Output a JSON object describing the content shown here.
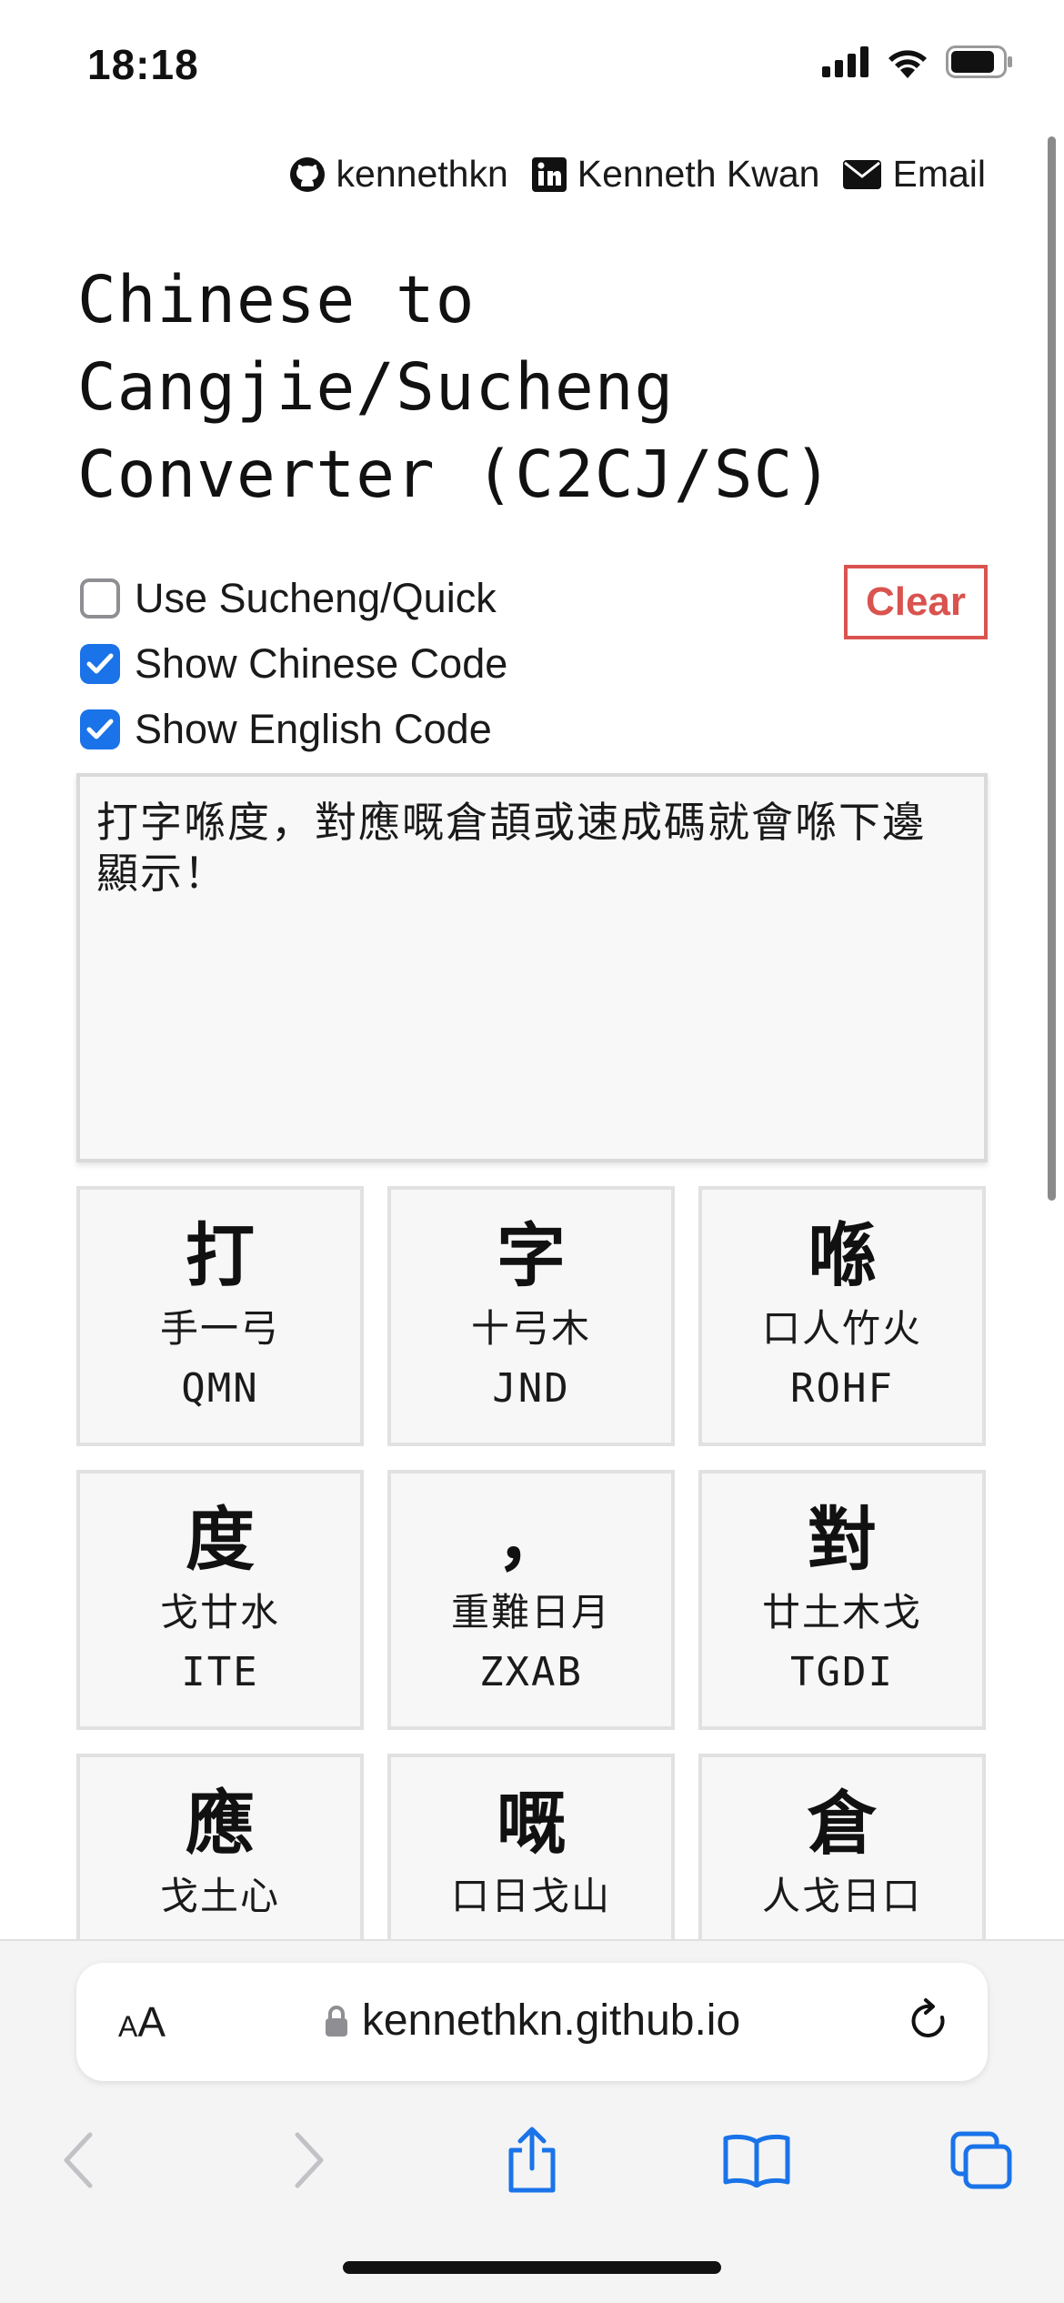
{
  "status_bar": {
    "time": "18:18"
  },
  "social": {
    "github": "kennethkn",
    "linkedin": "Kenneth Kwan",
    "email": "Email"
  },
  "title": "Chinese to Cangjie/Sucheng Converter (C2CJ/SC)",
  "options": {
    "sucheng": {
      "label": "Use Sucheng/Quick",
      "checked": false
    },
    "chinese_code": {
      "label": "Show Chinese Code",
      "checked": true
    },
    "english_code": {
      "label": "Show English Code",
      "checked": true
    }
  },
  "clear_label": "Clear",
  "input_text": "打字喺度，對應嘅倉頡或速成碼就會喺下邊顯示！",
  "results": [
    {
      "char": "打",
      "radicals": "手一弓",
      "code": "QMN"
    },
    {
      "char": "字",
      "radicals": "十弓木",
      "code": "JND"
    },
    {
      "char": "喺",
      "radicals": "口人竹火",
      "code": "ROHF"
    },
    {
      "char": "度",
      "radicals": "戈廿水",
      "code": "ITE"
    },
    {
      "char": "，",
      "radicals": "重難日月",
      "code": "ZXAB"
    },
    {
      "char": "對",
      "radicals": "廿土木戈",
      "code": "TGDI"
    },
    {
      "char": "應",
      "radicals": "戈土心",
      "code": ""
    },
    {
      "char": "嘅",
      "radicals": "口日戈山",
      "code": ""
    },
    {
      "char": "倉",
      "radicals": "人戈日口",
      "code": ""
    }
  ],
  "browser": {
    "text_size_label_small": "A",
    "text_size_label_large": "A",
    "url": "kennethkn.github.io"
  },
  "colors": {
    "accent": "#1a73e8",
    "clear": "#d9534f"
  }
}
